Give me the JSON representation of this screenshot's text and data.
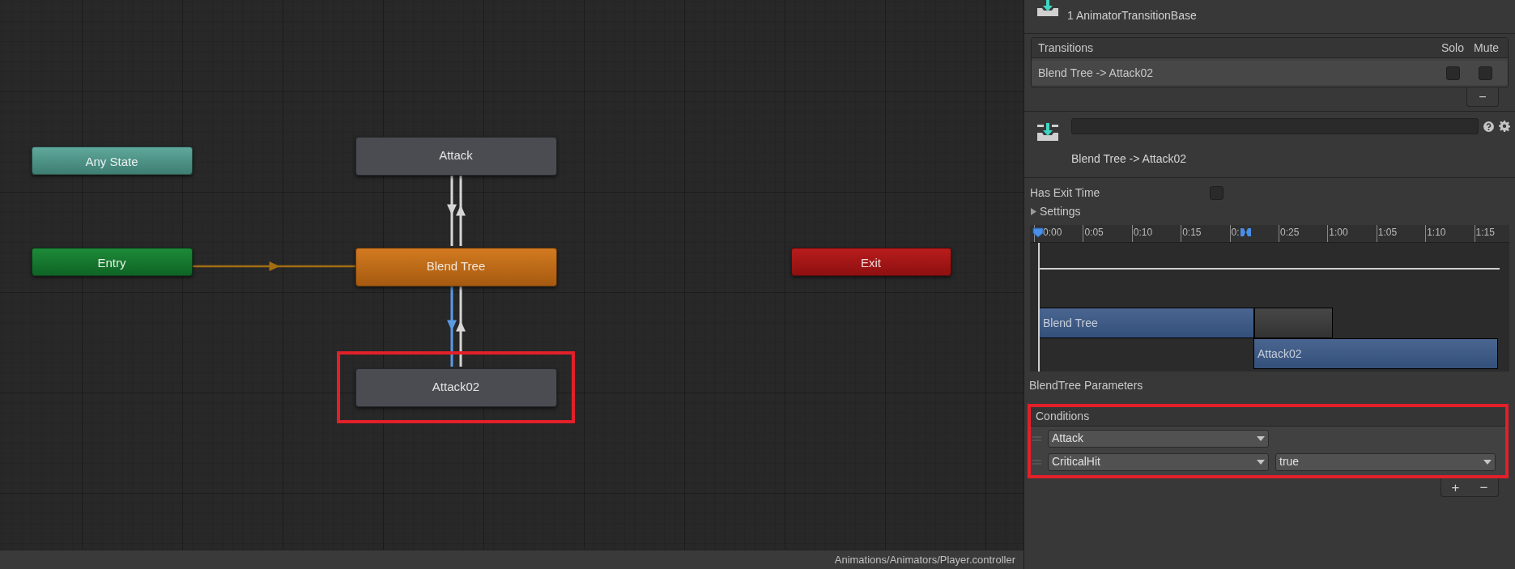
{
  "graph": {
    "nodes": [
      {
        "label": "Any State",
        "kind": "any_state",
        "highlighted": false
      },
      {
        "label": "Attack",
        "kind": "state",
        "highlighted": false
      },
      {
        "label": "Entry",
        "kind": "entry",
        "highlighted": false
      },
      {
        "label": "Blend Tree",
        "kind": "default",
        "highlighted": false
      },
      {
        "label": "Exit",
        "kind": "exit",
        "highlighted": false
      },
      {
        "label": "Attack02",
        "kind": "state",
        "highlighted": true
      }
    ],
    "transitions": [
      {
        "kind": "default",
        "selected": false
      },
      {
        "kind": "normal",
        "selected": false
      },
      {
        "kind": "normal",
        "selected": false
      },
      {
        "kind": "normal",
        "selected": true
      },
      {
        "kind": "normal",
        "selected": false
      }
    ]
  },
  "status_bar": {
    "path": "Animations/Animators/Player.controller"
  },
  "inspector": {
    "header": "1 AnimatorTransitionBase",
    "transitions_list": {
      "columns": [
        "Transitions",
        "Solo",
        "Mute"
      ],
      "rows": [
        {
          "label": "Blend Tree -> Attack02",
          "solo": false,
          "mute": false
        }
      ],
      "remove_button": "−"
    },
    "transition_title": "Blend Tree -> Attack02",
    "has_exit_time": {
      "label": "Has Exit Time",
      "checked": false
    },
    "settings": {
      "label": "Settings",
      "expanded": false
    },
    "timeline": {
      "ticks": [
        "0:00",
        "0:05",
        "0:10",
        "0:15",
        "0:",
        "0:25",
        "1:00",
        "1:05",
        "1:10",
        "1:15"
      ],
      "tracks": [
        {
          "label": "Blend Tree"
        },
        {
          "label": "Attack02"
        }
      ]
    },
    "parameters_label": "BlendTree Parameters",
    "conditions": {
      "title": "Conditions",
      "highlighted": true,
      "rows": [
        {
          "parameter": "Attack"
        },
        {
          "parameter": "CriticalHit",
          "value": "true"
        }
      ],
      "buttons": [
        "+",
        "−"
      ]
    }
  }
}
